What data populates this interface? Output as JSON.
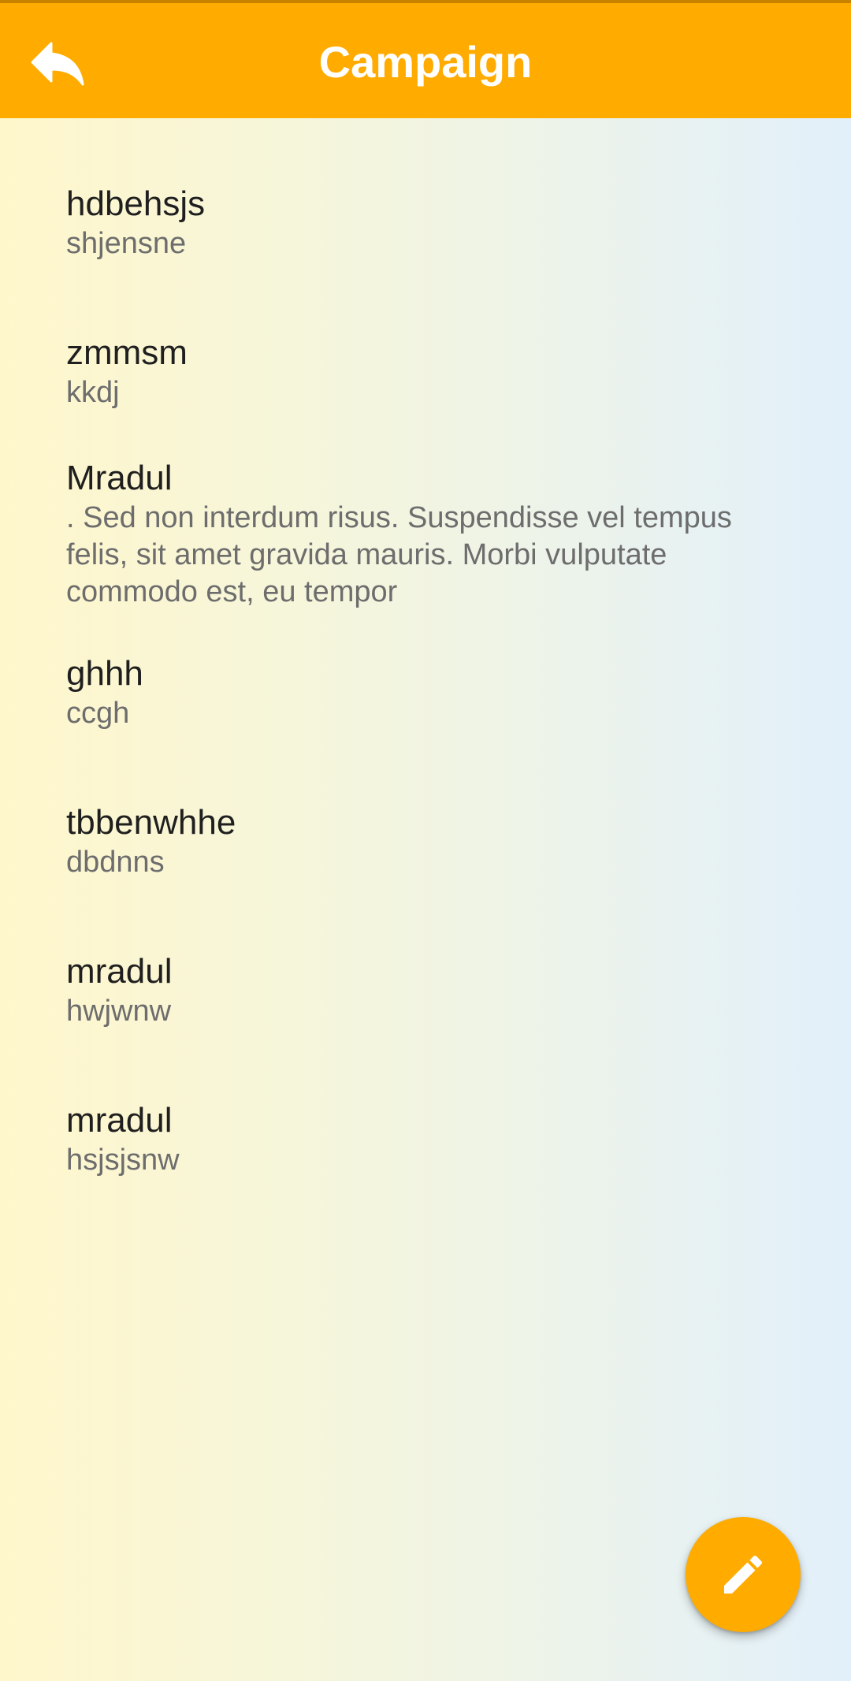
{
  "header": {
    "title": "Campaign",
    "back_icon": "reply-arrow-icon"
  },
  "campaigns": [
    {
      "title": "hdbehsjs",
      "subtitle": "shjensne"
    },
    {
      "title": "zmmsm",
      "subtitle": "kkdj"
    },
    {
      "title": "Mradul",
      "subtitle": ". Sed non interdum risus. Suspendisse vel tempus felis, sit amet gravida mauris. Morbi vulputate commodo est, eu tempor"
    },
    {
      "title": "ghhh",
      "subtitle": "ccgh"
    },
    {
      "title": "tbbenwhhe",
      "subtitle": "dbdnns"
    },
    {
      "title": "mradul",
      "subtitle": "hwjwnw"
    },
    {
      "title": "mradul",
      "subtitle": "hsjsjsnw"
    }
  ],
  "fab": {
    "icon": "pencil-edit-icon",
    "color": "#FFAB00"
  },
  "colors": {
    "accent": "#FFAB00",
    "title_text": "#1F1F1F",
    "subtitle_text": "#6D6D6D"
  }
}
